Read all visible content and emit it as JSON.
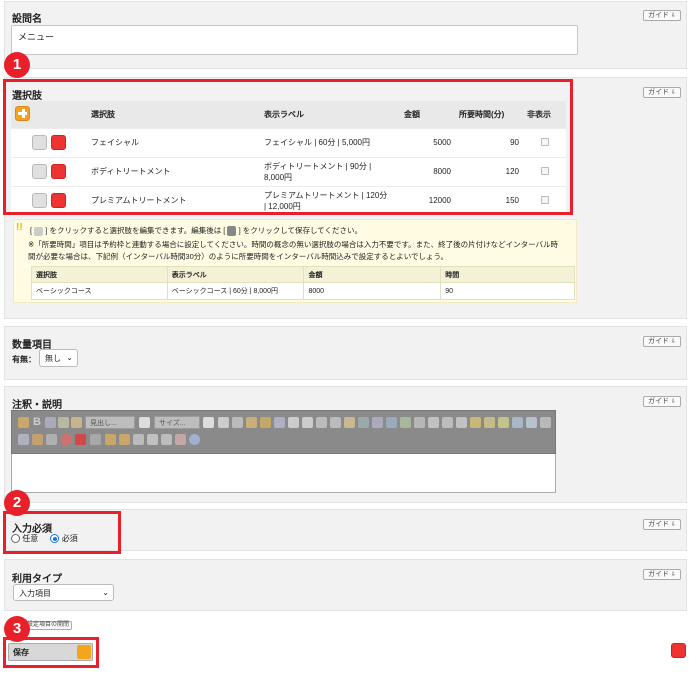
{
  "guide_label": "ガイド",
  "question_name": {
    "title": "設問名",
    "value": "メニュー"
  },
  "choices": {
    "title": "選択肢",
    "headers": [
      "選択肢",
      "表示ラベル",
      "金額",
      "所要時間(分)",
      "非表示"
    ],
    "rows": [
      {
        "name": "フェイシャル",
        "label": "フェイシャル | 60分 | 5,000円",
        "label2": "",
        "price": "5000",
        "time": "90"
      },
      {
        "name": "ボディトリートメント",
        "label": "ボディトリートメント | 90分 |",
        "label2": "8,000円",
        "price": "8000",
        "time": "120"
      },
      {
        "name": "プレミアムトリートメント",
        "label": "プレミアムトリートメント | 120分",
        "label2": "| 12,000円",
        "price": "12000",
        "time": "150"
      }
    ]
  },
  "note": {
    "line1_pre": "[",
    "line1_mid": "] をクリックすると選択肢を編集できます。編集後は [",
    "line1_post": "] をクリックして保存してください。",
    "line2": "※「所要時間」項目は予約枠と連動する場合に設定してください。時間の概念の無い選択肢の場合は入力不要です。また、終了後の片付けなどインターバル時",
    "line3": "間が必要な場合は、下記例（インターバル時間30分）のように所要時間をインターバル時間込みで設定するとよいでしょう。",
    "example_headers": [
      "選択肢",
      "表示ラベル",
      "金額",
      "時間"
    ],
    "example_row": [
      "ベーシックコース",
      "ベーシックコース | 60分 | 8,000円",
      "8000",
      "90"
    ]
  },
  "quantity": {
    "title": "数量項目",
    "label": "有無：",
    "value": "無し"
  },
  "annotation": {
    "title": "注釈・説明",
    "heading_select": "見出し...",
    "size_select": "サイズ..."
  },
  "required": {
    "title": "入力必須",
    "options": [
      "任意",
      "必須"
    ],
    "selected": "必須"
  },
  "usage_type": {
    "title": "利用タイプ",
    "value": "入力項目"
  },
  "settings_link": "設定項目の開閉",
  "save_label": "保存",
  "callouts": [
    "1",
    "2",
    "3"
  ]
}
